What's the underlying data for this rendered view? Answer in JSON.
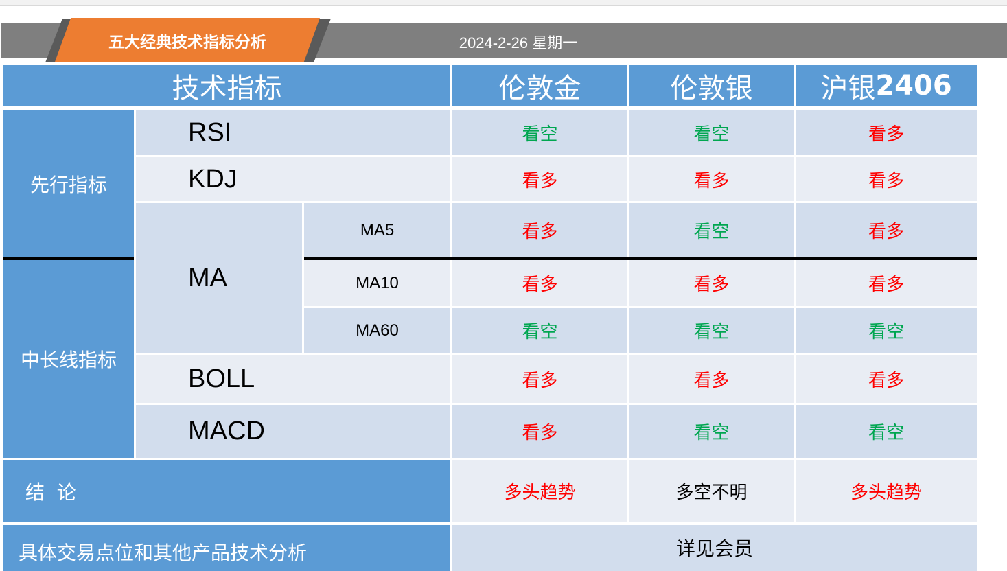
{
  "header": {
    "title": "五大经典技术指标分析",
    "date": "2024-2-26 星期一"
  },
  "table": {
    "col_header": "技术指标",
    "instruments": [
      {
        "name": "伦敦金",
        "suffix": ""
      },
      {
        "name": "伦敦银",
        "suffix": ""
      },
      {
        "name": "沪银",
        "suffix": "2406"
      }
    ],
    "groups": {
      "leading": "先行指标",
      "mid_long": "中长线指标"
    },
    "indicators": {
      "rsi": "RSI",
      "kdj": "KDJ",
      "ma": "MA",
      "ma5": "MA5",
      "ma10": "MA10",
      "ma60": "MA60",
      "boll": "BOLL",
      "macd": "MACD"
    },
    "signals": {
      "rsi": [
        "看空",
        "看空",
        "看多"
      ],
      "kdj": [
        "看多",
        "看多",
        "看多"
      ],
      "ma5": [
        "看多",
        "看空",
        "看多"
      ],
      "ma10": [
        "看多",
        "看多",
        "看多"
      ],
      "ma60": [
        "看空",
        "看空",
        "看空"
      ],
      "boll": [
        "看多",
        "看多",
        "看多"
      ],
      "macd": [
        "看多",
        "看空",
        "看空"
      ]
    },
    "conclusion": {
      "label": "结  论",
      "values": [
        "多头趋势",
        "多空不明",
        "多头趋势"
      ]
    },
    "footer": {
      "label": "具体交易点位和其他产品技术分析",
      "value": "详见会员"
    }
  },
  "colors": {
    "bullish": "#ff0000",
    "bearish": "#00a650",
    "header_blue": "#5b9bd5",
    "tab_orange": "#ed7d31"
  }
}
